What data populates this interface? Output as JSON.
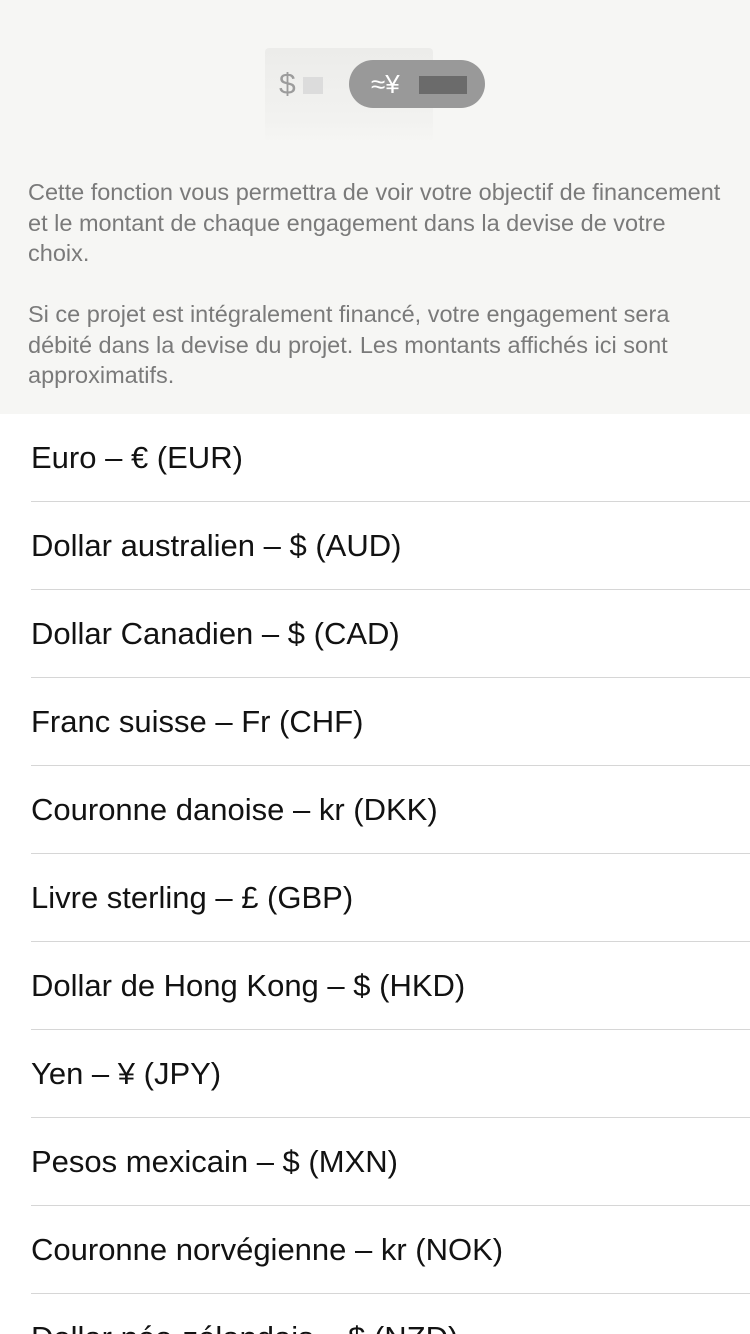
{
  "header": {
    "illustration": {
      "dollar_symbol": "$",
      "yen_symbol": "≈¥"
    },
    "description_1": "Cette fonction vous permettra de voir votre objectif de financement et le montant de chaque engagement dans la devise de votre choix.",
    "description_2": "Si ce projet est intégralement financé, votre engagement sera débité dans la devise du projet. Les montants affichés ici sont approximatifs."
  },
  "currencies": [
    {
      "label": "Euro – € (EUR)"
    },
    {
      "label": "Dollar australien – $ (AUD)"
    },
    {
      "label": "Dollar Canadien – $ (CAD)"
    },
    {
      "label": "Franc suisse – Fr (CHF)"
    },
    {
      "label": "Couronne danoise – kr (DKK)"
    },
    {
      "label": "Livre sterling – £ (GBP)"
    },
    {
      "label": "Dollar de Hong Kong – $ (HKD)"
    },
    {
      "label": "Yen – ¥ (JPY)"
    },
    {
      "label": "Pesos mexicain – $ (MXN)"
    },
    {
      "label": "Couronne norvégienne – kr (NOK)"
    },
    {
      "label": "Dollar néo-zélandais – $ (NZD)"
    }
  ],
  "colors": {
    "header_background": "#f6f6f4",
    "description_text": "#7a7a7a",
    "list_text": "#121212",
    "separator": "#d6d6d6",
    "pill": "#999999"
  }
}
